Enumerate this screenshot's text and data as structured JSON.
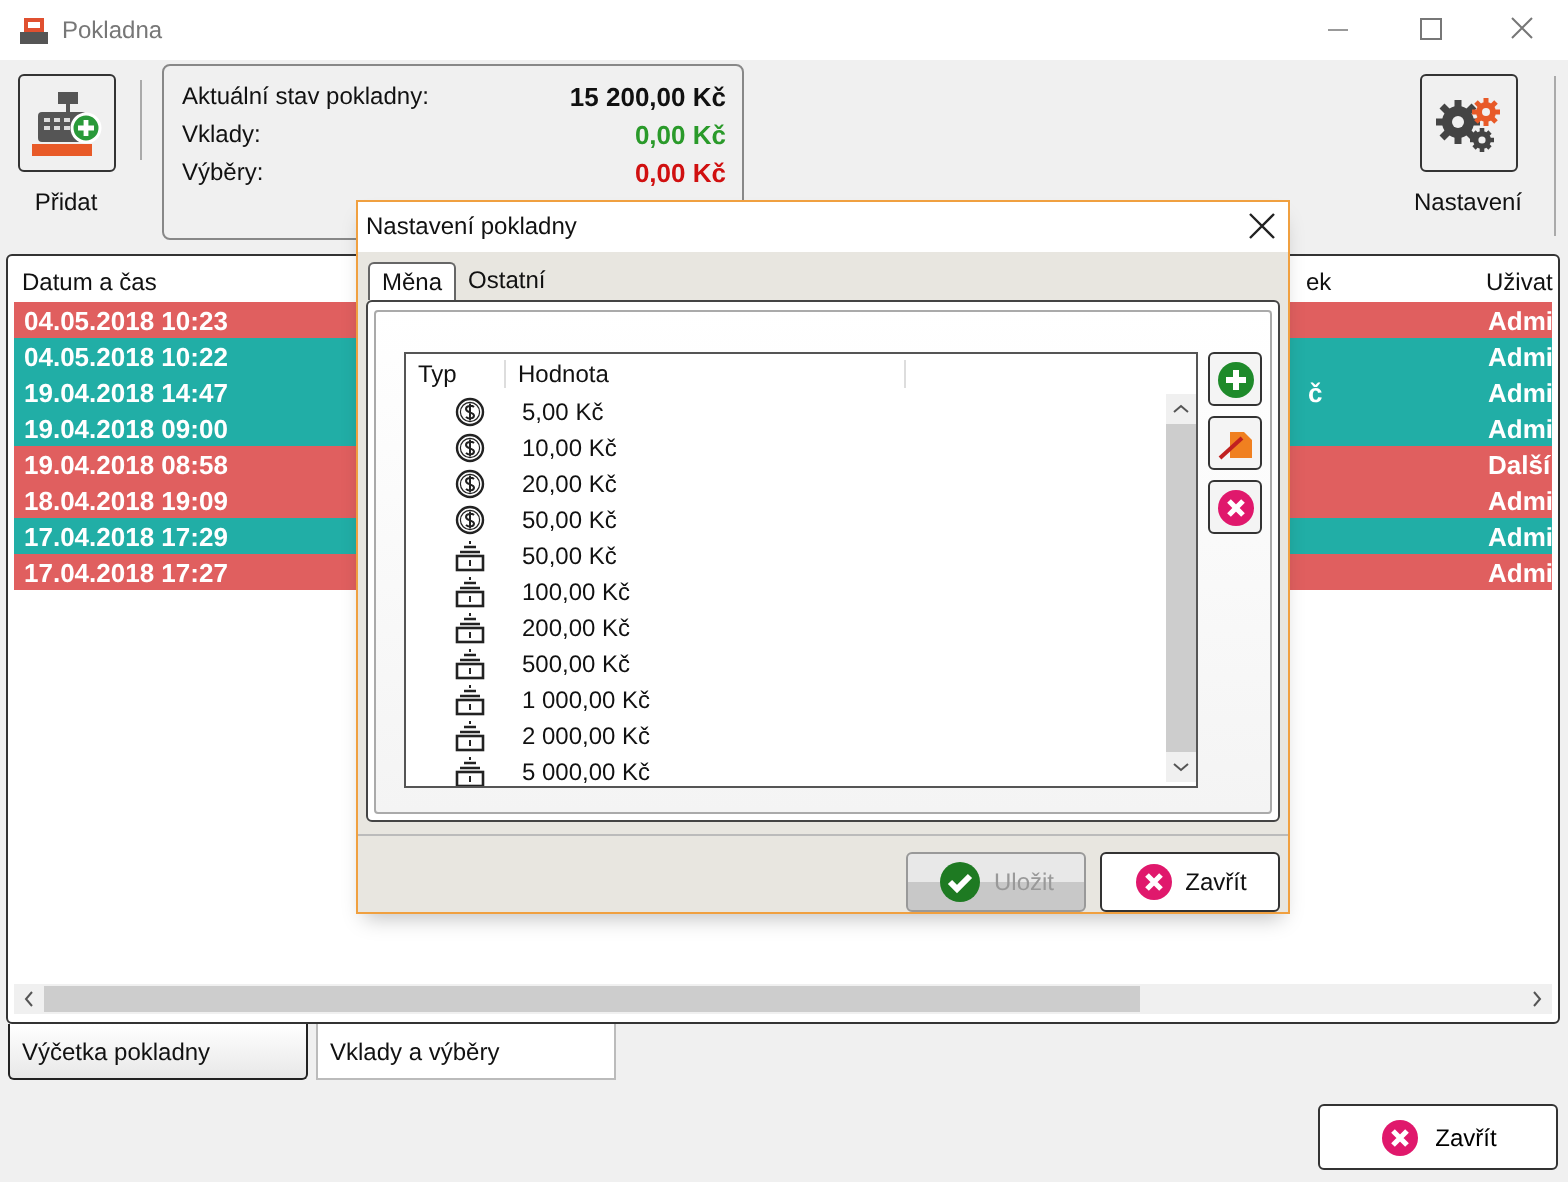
{
  "window": {
    "title": "Pokladna"
  },
  "toolbar": {
    "add_label": "Přidat",
    "settings_label": "Nastavení"
  },
  "summary": [
    {
      "label": "Aktuální stav pokladny:",
      "value": "15 200,00 Kč",
      "kind": "total"
    },
    {
      "label": "Vklady:",
      "value": "0,00 Kč",
      "kind": "plus"
    },
    {
      "label": "Výběry:",
      "value": "0,00 Kč",
      "kind": "minus"
    }
  ],
  "table": {
    "columns": [
      "Datum a čas",
      "ek",
      "Uživat"
    ],
    "rows": [
      {
        "date": "04.05.2018 10:23",
        "column_3": "",
        "user": "Admi",
        "color": "#e05f5f"
      },
      {
        "date": "04.05.2018 10:22",
        "column_3": "",
        "user": "Admi",
        "color": "#21aea6"
      },
      {
        "date": "19.04.2018 14:47",
        "column_3": "č",
        "user": "Admi",
        "color": "#21aea6"
      },
      {
        "date": "19.04.2018 09:00",
        "column_3": "",
        "user": "Admi",
        "color": "#21aea6"
      },
      {
        "date": "19.04.2018 08:58",
        "column_3": "",
        "user": "Další",
        "color": "#e05f5f"
      },
      {
        "date": "18.04.2018 19:09",
        "column_3": "",
        "user": "Admi",
        "color": "#e05f5f"
      },
      {
        "date": "17.04.2018 17:29",
        "column_3": "",
        "user": "Admi",
        "color": "#21aea6"
      },
      {
        "date": "17.04.2018 17:27",
        "column_3": "",
        "user": "Admi",
        "color": "#e05f5f"
      }
    ]
  },
  "bottom_tabs": [
    {
      "label": "Výčetka pokladny",
      "selected": true
    },
    {
      "label": "Vklady a výběry",
      "selected": false
    }
  ],
  "close_button": "Zavřít",
  "dialog": {
    "title": "Nastavení pokladny",
    "tabs": [
      {
        "label": "Měna",
        "selected": true
      },
      {
        "label": "Ostatní",
        "selected": false
      }
    ],
    "columns": [
      "Typ",
      "Hodnota"
    ],
    "items": [
      {
        "kind": "coin",
        "value": "5,00 Kč"
      },
      {
        "kind": "coin",
        "value": "10,00 Kč"
      },
      {
        "kind": "coin",
        "value": "20,00 Kč"
      },
      {
        "kind": "coin",
        "value": "50,00 Kč"
      },
      {
        "kind": "note",
        "value": "50,00 Kč"
      },
      {
        "kind": "note",
        "value": "100,00 Kč"
      },
      {
        "kind": "note",
        "value": "200,00 Kč"
      },
      {
        "kind": "note",
        "value": "500,00 Kč"
      },
      {
        "kind": "note",
        "value": "1 000,00 Kč"
      },
      {
        "kind": "note",
        "value": "2 000,00 Kč"
      },
      {
        "kind": "note",
        "value": "5 000,00 Kč"
      }
    ],
    "save_button": {
      "label": "Uložit",
      "disabled": true
    },
    "close_button": "Zavřít"
  }
}
